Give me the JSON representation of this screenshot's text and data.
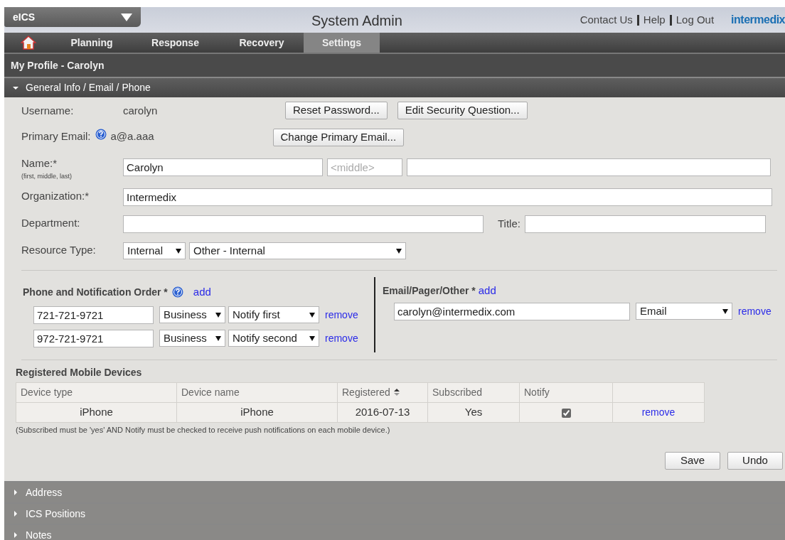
{
  "app_menu": {
    "label": "eICS"
  },
  "header": {
    "title": "System Admin",
    "links": [
      "Contact Us",
      "Help",
      "Log Out"
    ],
    "logo": "intermedix"
  },
  "nav_tabs": [
    {
      "label": "Planning",
      "selected": false
    },
    {
      "label": "Response",
      "selected": false
    },
    {
      "label": "Recovery",
      "selected": false
    },
    {
      "label": "Settings",
      "selected": true
    }
  ],
  "page_title": "My Profile - Carolyn",
  "sections": [
    {
      "title": "General Info / Email / Phone",
      "expanded": true
    },
    {
      "title": "Address",
      "expanded": false
    },
    {
      "title": "ICS Positions",
      "expanded": false
    },
    {
      "title": "Notes",
      "expanded": false
    }
  ],
  "general": {
    "username": {
      "label": "Username:",
      "value": "carolyn",
      "buttons": [
        "Reset Password...",
        "Edit Security Question..."
      ]
    },
    "primary_email": {
      "label": "Primary Email:",
      "value": "a@a.aaa",
      "buttons": [
        "Change Primary Email..."
      ]
    },
    "name": {
      "label": "Name:*",
      "hint": "(first, middle, last)",
      "fields": [
        {
          "value": "Carolyn"
        },
        {
          "placeholder": "<middle>"
        }
      ]
    },
    "organization": {
      "label": "Organization:*",
      "value": "Intermedix"
    },
    "department": {
      "label": "Department:",
      "title_label": "Title:"
    },
    "resource_type": {
      "label": "Resource Type:",
      "selects": [
        "Internal",
        "Other - Internal"
      ]
    },
    "phones": {
      "title": "Phone and Notification Order *",
      "add": "add",
      "rows": [
        {
          "number": "721-721-9721",
          "type": "Business",
          "order": "Notify first",
          "remove": "remove"
        },
        {
          "number": "972-721-9721",
          "type": "Business",
          "order": "Notify second",
          "remove": "remove"
        }
      ]
    },
    "emails": {
      "title": "Email/Pager/Other *",
      "add": "add",
      "rows": [
        {
          "address": "carolyn@intermedix.com",
          "type": "Email",
          "remove": "remove"
        }
      ]
    },
    "devices": {
      "title": "Registered Mobile Devices",
      "columns": [
        "Device type",
        "Device name",
        "Registered",
        "Subscribed",
        "Notify"
      ],
      "rows": [
        {
          "device_type": "iPhone",
          "device_name": "iPhone",
          "registered": "2016-07-13",
          "subscribed": "Yes",
          "notify": true,
          "action": "remove"
        }
      ],
      "note": "(Subscribed must be 'yes' AND Notify must be checked to receive push notifications on each mobile device.)"
    },
    "buttons": [
      "Save",
      "Undo"
    ]
  }
}
